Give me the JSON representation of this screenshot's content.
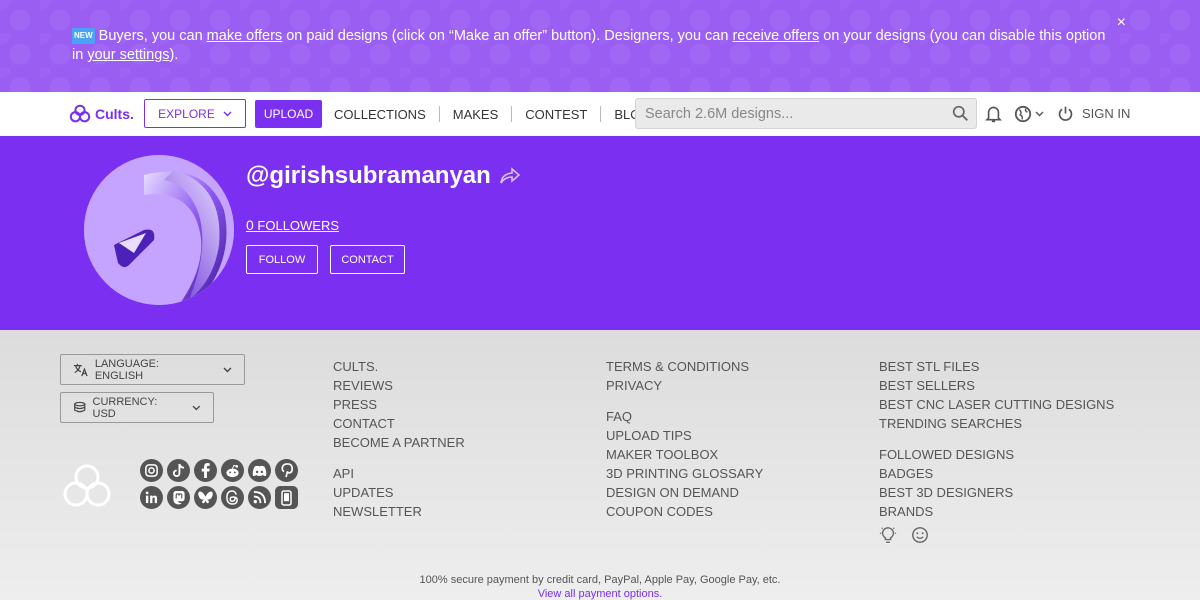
{
  "banner": {
    "new_badge": "NEW",
    "text_1": "Buyers, you can ",
    "link_make_offers": "make offers",
    "text_2": " on paid designs (click on “Make an offer” button). Designers, you can ",
    "link_receive_offers": "receive offers",
    "text_3": " on your designs (you can disable this option in ",
    "link_settings": "your settings",
    "text_4": ").",
    "close": "×"
  },
  "nav": {
    "logo_text": "Cults.",
    "explore": "EXPLORE",
    "upload": "UPLOAD",
    "links": [
      "COLLECTIONS",
      "MAKES",
      "CONTEST",
      "BLOG"
    ],
    "search_placeholder": "Search 2.6M designs...",
    "sign_in": "SIGN IN"
  },
  "profile": {
    "username": "@girishsubramanyan",
    "followers_count": "0",
    "followers_label": " FOLLOWERS",
    "follow": "FOLLOW",
    "contact": "CONTACT"
  },
  "footer": {
    "language": "LANGUAGE: ENGLISH",
    "currency": "CURRENCY: USD",
    "col1_a": [
      "CULTS.",
      "REVIEWS",
      "PRESS",
      "CONTACT",
      "BECOME A PARTNER"
    ],
    "col1_b": [
      "API",
      "UPDATES",
      "NEWSLETTER"
    ],
    "col2_a": [
      "TERMS & CONDITIONS",
      "PRIVACY"
    ],
    "col2_b": [
      "FAQ",
      "UPLOAD TIPS",
      "MAKER TOOLBOX",
      "3D PRINTING GLOSSARY",
      "DESIGN ON DEMAND",
      "COUPON CODES"
    ],
    "col3_a": [
      "BEST STL FILES",
      "BEST SELLERS",
      "BEST CNC LASER CUTTING DESIGNS",
      "TRENDING SEARCHES"
    ],
    "col3_b": [
      "FOLLOWED DESIGNS",
      "BADGES",
      "BEST 3D DESIGNERS",
      "BRANDS"
    ],
    "socials_row1": [
      "instagram-icon",
      "tiktok-icon",
      "facebook-icon",
      "reddit-icon",
      "discord-icon",
      "pinterest-icon"
    ],
    "socials_row2": [
      "linkedin-icon",
      "mastodon-icon",
      "bluesky-icon",
      "threads-icon",
      "rss-icon",
      "mobile-app-icon"
    ],
    "payment_note": "100% secure payment by credit card, PayPal, Apple Pay, Google Pay, etc.",
    "payment_link": "View all payment options."
  },
  "colors": {
    "brand_purple": "#7b2ff0",
    "banner_purple": "#9a5ef3"
  }
}
